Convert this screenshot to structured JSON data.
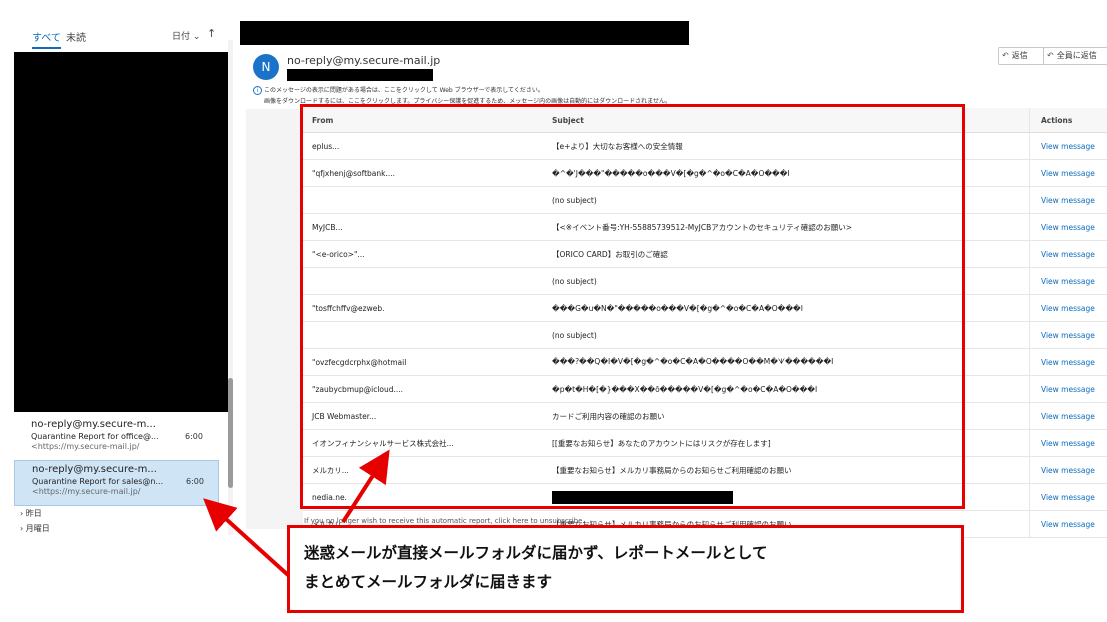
{
  "left": {
    "tabs": [
      "すべて",
      "未読"
    ],
    "sort_label": "日付 ⌄",
    "sort_arrow": "↑",
    "mails": [
      {
        "sender": "no-reply@my.secure-m...",
        "subject": "Quarantine Report for office@...",
        "preview": "<https://my.secure-mail.jp/",
        "time": "6:00"
      },
      {
        "sender": "no-reply@my.secure-m...",
        "subject": "Quarantine Report for sales@n...",
        "preview": "<https://my.secure-mail.jp/",
        "time": "6:00"
      }
    ],
    "groups": [
      "› 昨日",
      "› 月曜日"
    ]
  },
  "message": {
    "avatar_letter": "N",
    "from": "no-reply@my.secure-mail.jp",
    "info_icon": "info-icon",
    "info_line1": "このメッセージの表示に問題がある場合は、ここをクリックして Web ブラウザーで表示してください。",
    "info_line2": "画像をダウンロードするには、ここをクリックします。プライバシー保護を促進するため、メッセージ内の画像は自動的にはダウンロードされません。",
    "toolbar": {
      "reply": "返信",
      "reply_all": "全員に返信"
    }
  },
  "report": {
    "headers": [
      "From",
      "Subject",
      "Actions"
    ],
    "rows": [
      [
        "eplus...",
        "【e+より】大切なお客様への安全情報",
        "View message"
      ],
      [
        "\"qfjxhenj@softbank....",
        "�^�'J���\"�����o���V�[�g�^�o�C�A�O���I",
        "View message"
      ],
      [
        "",
        "(no subject)",
        "View message"
      ],
      [
        "MyJCB...",
        "【<※イベント番号:YH-55885739512-MyJCBアカウントのセキュリティ確認のお願い>",
        "View message"
      ],
      [
        "\"<e-orico>\"...",
        "【ORICO CARD】お取引のご確認",
        "View message"
      ],
      [
        "",
        "(no subject)",
        "View message"
      ],
      [
        "\"tosffchffv@ezweb.",
        "���G�u�N�\"�����o���V�[�g�^�o�C�A�O���I",
        "View message"
      ],
      [
        "",
        "(no subject)",
        "View message"
      ],
      [
        "\"ovzfecgdcrphx@hotmail",
        "���?��Q�I�V�[�g�^�o�C�A�O����O��M�ᗐ������I",
        "View message"
      ],
      [
        "\"zaubycbmup@icloud....",
        "�p�t�H�[�}���X��ō�����V�[�g�^�o�C�A�O���I",
        "View message"
      ],
      [
        "JCB Webmaster...",
        "カードご利用内容の確認のお願い",
        "View message"
      ],
      [
        "イオンフィナンシャルサービス株式会社...",
        "[[重要なお知らせ】あなたのアカウントにはリスクが存在します]",
        "View message"
      ],
      [
        "メルカリ...",
        "【重要なお知らせ】メルカリ事務局からのお知らせご利用確認のお願い",
        "View message"
      ],
      [
        "nedia.ne.",
        "",
        "View message"
      ],
      [
        "メルカリ...",
        "【重要なお知らせ】メルカリ事務局からのお知らせご利用確認のお願い",
        "View message"
      ]
    ],
    "footer": "If you no longer wish to receive this automatic report, click here to unsubscribe."
  },
  "callout": {
    "text": "迷惑メールが直接メールフォルダに届かず、レポートメールとして\nまとめてメールフォルダに届きます"
  },
  "colors": {
    "accent": "#0f6cbd",
    "highlight": "#e60000",
    "selected": "#cfe4f5"
  }
}
